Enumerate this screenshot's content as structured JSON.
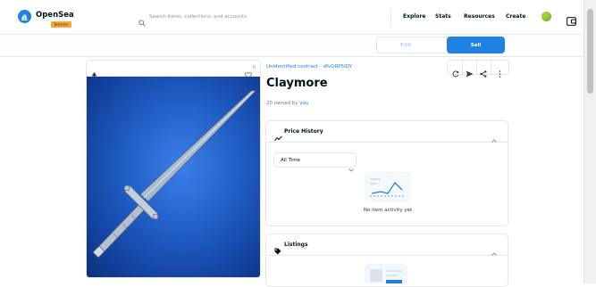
{
  "brand": {
    "name": "OpenSea",
    "badge": "Testnets"
  },
  "search": {
    "placeholder": "Search items, collections, and accounts"
  },
  "nav": {
    "explore": "Explore",
    "stats": "Stats",
    "resources": "Resources",
    "create": "Create"
  },
  "actions": {
    "edit": "Edit",
    "sell": "Sell"
  },
  "media": {
    "favorites": "0"
  },
  "item": {
    "collection": "Unidentified contract - dfvGRP5IDY",
    "title": "Claymore",
    "owned_count": "20 owned by",
    "owner": "you"
  },
  "price_history": {
    "title": "Price History",
    "time_range": "All Time",
    "empty_text": "No item activity yet"
  },
  "listings": {
    "title": "Listings"
  },
  "colors": {
    "accent": "#2081e2",
    "badge": "#f3a63b",
    "profile": "#9fd43a"
  },
  "icons": [
    "opensea-logo-icon",
    "search-icon",
    "profile-icon",
    "wallet-icon",
    "eth-icon",
    "heart-icon",
    "refresh-icon",
    "send-icon",
    "share-icon",
    "more-icon",
    "trend-icon",
    "tag-icon",
    "chevron-up-icon",
    "chevron-down-icon"
  ]
}
